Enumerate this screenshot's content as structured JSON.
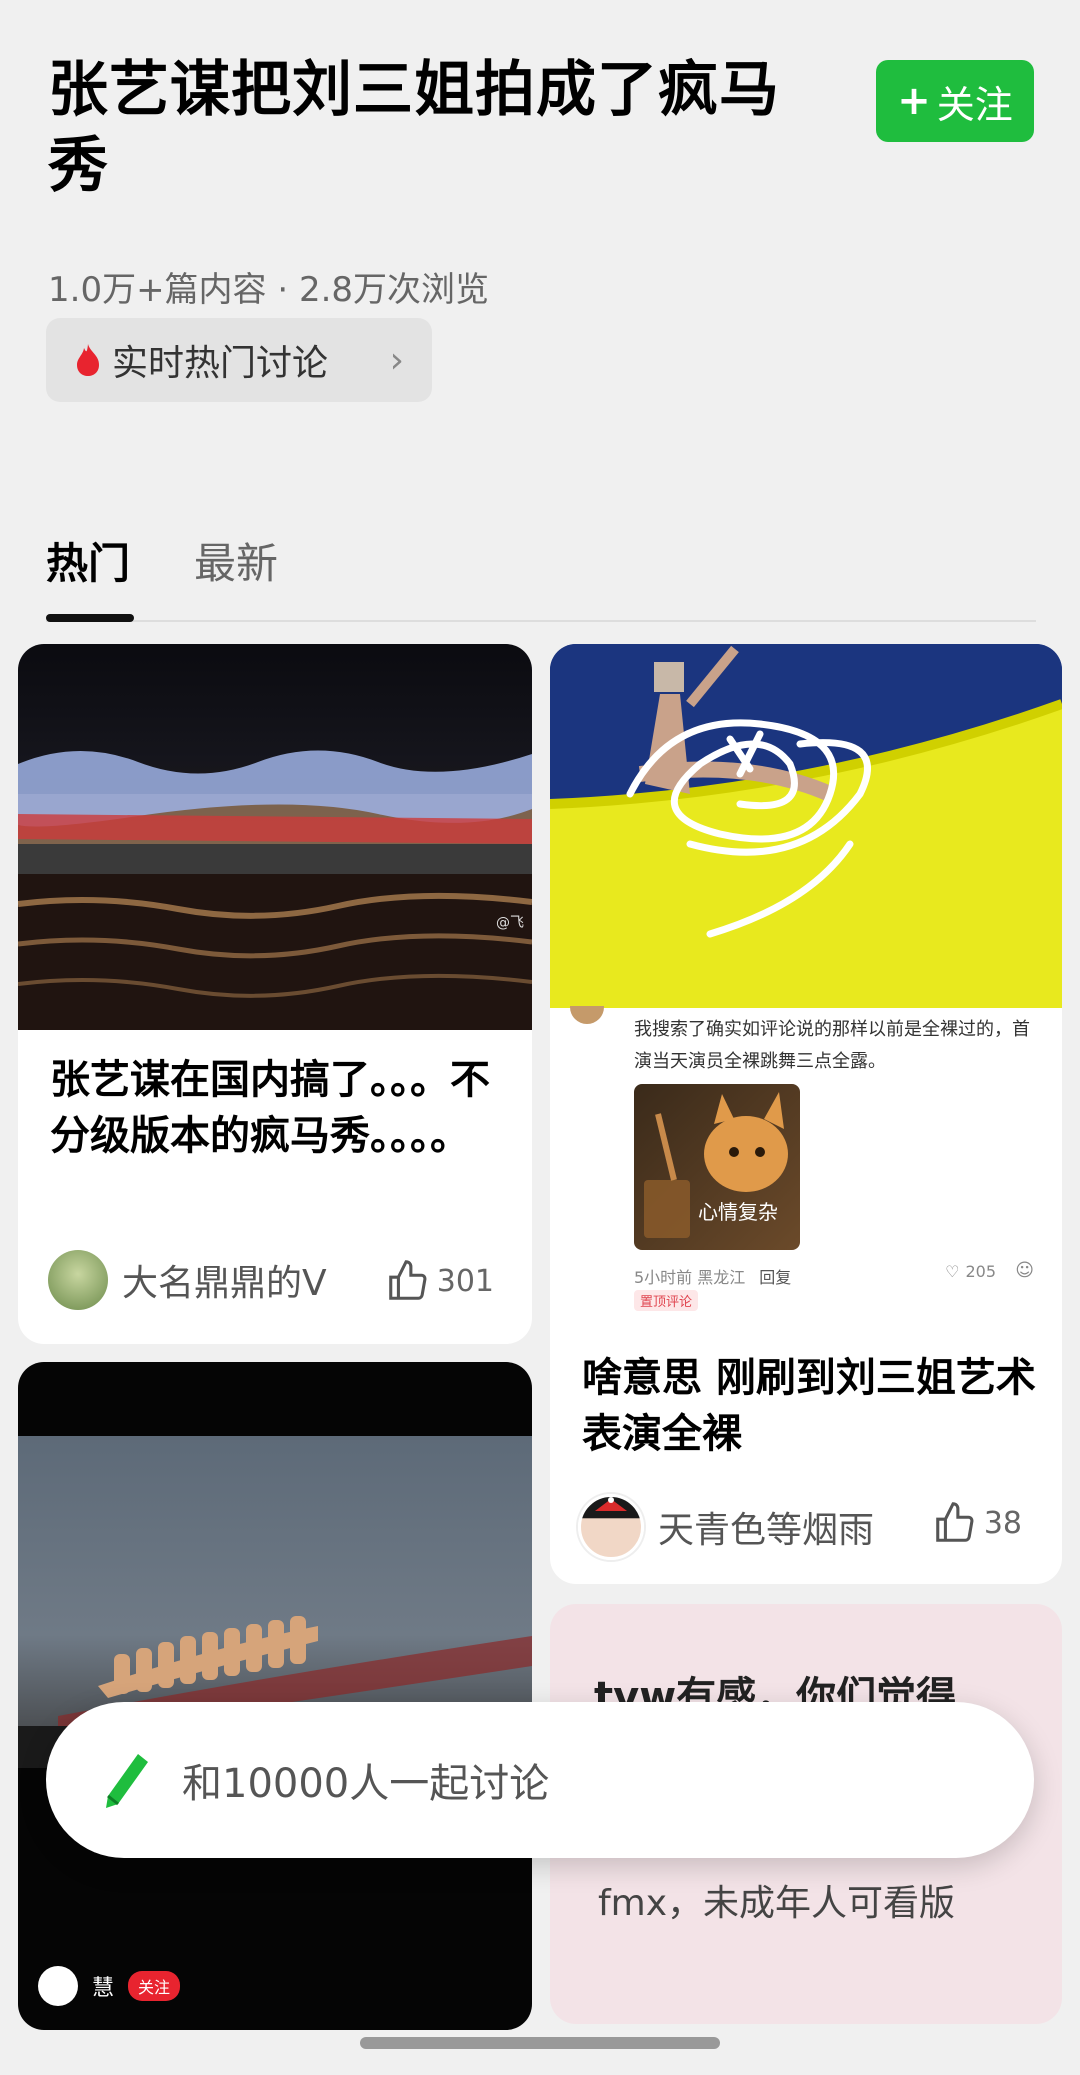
{
  "header": {
    "title": "张艺谋把刘三姐拍成了疯马秀",
    "follow_label": "关注",
    "stats": "1.0万+篇内容 · 2.8万次浏览",
    "hot_chip_label": "实时热门讨论"
  },
  "tabs": [
    {
      "label": "热门"
    },
    {
      "label": "最新"
    }
  ],
  "cards": [
    {
      "title": "张艺谋在国内搞了。。。不分级版本的疯马秀。。。。",
      "author": "大名鼎鼎的V",
      "likes": "301",
      "image_watermark": "@飞"
    },
    {
      "comment_text": "我搜索了确实如评论说的那样以前是全裸过的，首演当天演员全裸跳舞三点全露。",
      "comment_image_caption": "心情复杂",
      "comment_meta": "5小时前 黑龙江",
      "comment_reply": "回复",
      "comment_likes": "205",
      "comment_badge": "置顶评论",
      "title": "啥意思 刚刷到刘三姐艺术表演全裸",
      "author": "天青色等烟雨",
      "likes": "38"
    },
    {
      "author": "慧",
      "follow_label": "关注"
    },
    {
      "partial_heading": "tvw有感，你们觉得",
      "body_text": "fmx，未成年人可看版"
    }
  ],
  "composer": {
    "placeholder": "和10000人一起讨论"
  },
  "colors": {
    "accent_green": "#1fbd3e",
    "hot_red": "#e8242f"
  }
}
